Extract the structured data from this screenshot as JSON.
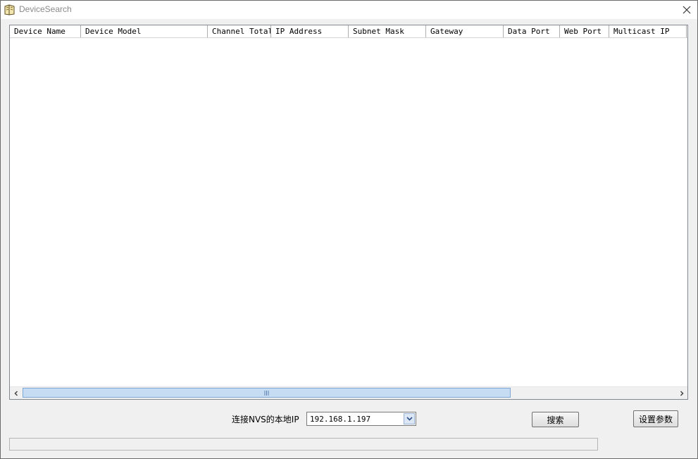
{
  "window": {
    "title": "DeviceSearch"
  },
  "table": {
    "columns": [
      "Device Name",
      "Device Model",
      "Channel Total",
      "IP Address",
      "Subnet Mask",
      "Gateway",
      "Data Port",
      "Web Port",
      "Multicast IP"
    ],
    "rows": []
  },
  "bottom": {
    "ip_label": "连接NVS的本地IP",
    "ip_value": "192.168.1.197",
    "search_button": "搜索",
    "settings_button": "设置参数"
  }
}
